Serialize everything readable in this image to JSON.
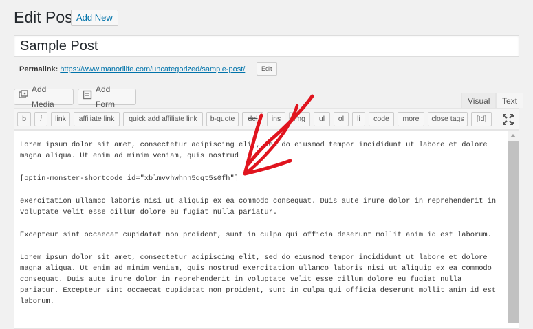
{
  "header": {
    "title": "Edit Post",
    "add_new_label": "Add New"
  },
  "post": {
    "title": "Sample Post"
  },
  "permalink": {
    "label": "Permalink:",
    "url": "https://www.manorilife.com/uncategorized/sample-post/",
    "edit_label": "Edit"
  },
  "media_buttons": [
    {
      "label": "Add Media",
      "icon": "media-icon"
    },
    {
      "label": "Add Form",
      "icon": "form-icon"
    }
  ],
  "editor_tabs": {
    "visual": "Visual",
    "text": "Text"
  },
  "quicktags": [
    "b",
    "i",
    "link",
    "affiliate link",
    "quick add affiliate link",
    "b-quote",
    "del",
    "ins",
    "img",
    "ul",
    "ol",
    "li",
    "code",
    "more",
    "close tags",
    "[Id]"
  ],
  "content": {
    "p1": "Lorem ipsum dolor sit amet, consectetur adipiscing elit, sed do eiusmod tempor incididunt ut labore et dolore\nmagna aliqua. Ut enim ad minim veniam, quis nostrud",
    "shortcode": "[optin-monster-shortcode id=\"xblmvvhwhnn5qqt5s0fh\"]",
    "p2": "exercitation ullamco laboris nisi ut aliquip ex ea commodo consequat. Duis aute irure dolor in reprehenderit in\nvoluptate velit esse cillum dolore eu fugiat nulla pariatur.",
    "p3": "Excepteur sint occaecat cupidatat non proident, sunt in culpa qui officia deserunt mollit anim id est laborum.",
    "p4": "Lorem ipsum dolor sit amet, consectetur adipiscing elit, sed do eiusmod tempor incididunt ut labore et dolore\nmagna aliqua. Ut enim ad minim veniam, quis nostrud exercitation ullamco laboris nisi ut aliquip ex ea commodo\nconsequat. Duis aute irure dolor in reprehenderit in voluptate velit esse cillum dolore eu fugiat nulla\npariatur. Excepteur sint occaecat cupidatat non proident, sunt in culpa qui officia deserunt mollit anim id est\nlaborum."
  },
  "colors": {
    "link": "#0073aa",
    "annotation": "#e0141e"
  }
}
